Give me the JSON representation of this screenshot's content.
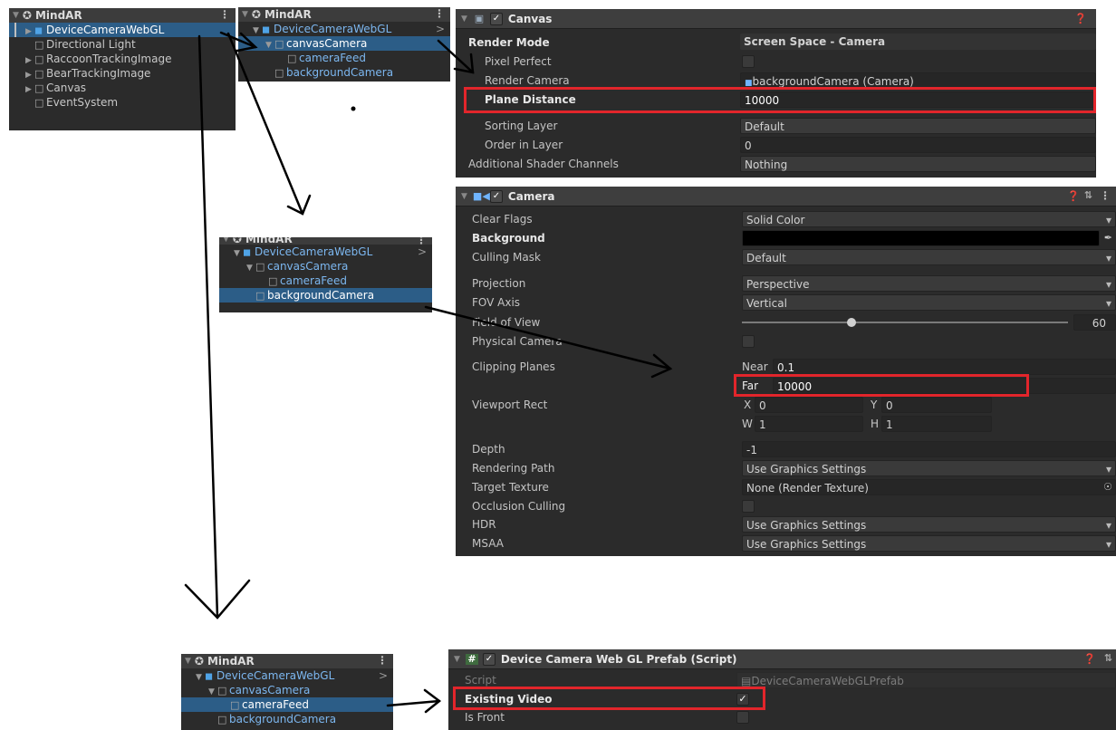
{
  "hierarchy1": {
    "title": "MindAR",
    "items": [
      {
        "label": "DeviceCameraWebGL"
      },
      {
        "label": "Directional Light"
      },
      {
        "label": "RaccoonTrackingImage"
      },
      {
        "label": "BearTrackingImage"
      },
      {
        "label": "Canvas"
      },
      {
        "label": "EventSystem"
      }
    ]
  },
  "hierarchy2": {
    "title": "MindAR",
    "items": [
      {
        "label": "DeviceCameraWebGL"
      },
      {
        "label": "canvasCamera"
      },
      {
        "label": "cameraFeed"
      },
      {
        "label": "backgroundCamera"
      }
    ]
  },
  "hierarchy3": {
    "title": "MindAR",
    "items": [
      {
        "label": "DeviceCameraWebGL"
      },
      {
        "label": "canvasCamera"
      },
      {
        "label": "cameraFeed"
      },
      {
        "label": "backgroundCamera"
      }
    ]
  },
  "hierarchy4": {
    "title": "MindAR",
    "items": [
      {
        "label": "DeviceCameraWebGL"
      },
      {
        "label": "canvasCamera"
      },
      {
        "label": "cameraFeed"
      },
      {
        "label": "backgroundCamera"
      }
    ]
  },
  "canvas_component": {
    "title": "Canvas",
    "render_mode_label": "Render Mode",
    "render_mode_value": "Screen Space - Camera",
    "pixel_perfect_label": "Pixel Perfect",
    "render_camera_label": "Render Camera",
    "render_camera_value": "backgroundCamera (Camera)",
    "plane_distance_label": "Plane Distance",
    "plane_distance_value": "10000",
    "sorting_layer_label": "Sorting Layer",
    "sorting_layer_value": "Default",
    "order_in_layer_label": "Order in Layer",
    "order_in_layer_value": "0",
    "shader_channels_label": "Additional Shader Channels",
    "shader_channels_value": "Nothing"
  },
  "camera_component": {
    "title": "Camera",
    "clear_flags_label": "Clear Flags",
    "clear_flags_value": "Solid Color",
    "background_label": "Background",
    "culling_mask_label": "Culling Mask",
    "culling_mask_value": "Default",
    "projection_label": "Projection",
    "projection_value": "Perspective",
    "fov_axis_label": "FOV Axis",
    "fov_axis_value": "Vertical",
    "fov_label": "Field of View",
    "fov_value": "60",
    "physical_camera_label": "Physical Camera",
    "clipping_label": "Clipping Planes",
    "near_label": "Near",
    "near_value": "0.1",
    "far_label": "Far",
    "far_value": "10000",
    "viewport_label": "Viewport Rect",
    "x_label": "X",
    "x_value": "0",
    "y_label": "Y",
    "y_value": "0",
    "w_label": "W",
    "w_value": "1",
    "h_label": "H",
    "h_value": "1",
    "depth_label": "Depth",
    "depth_value": "-1",
    "rendering_path_label": "Rendering Path",
    "rendering_path_value": "Use Graphics Settings",
    "target_texture_label": "Target Texture",
    "target_texture_value": "None (Render Texture)",
    "occlusion_label": "Occlusion Culling",
    "hdr_label": "HDR",
    "hdr_value": "Use Graphics Settings",
    "msaa_label": "MSAA",
    "msaa_value": "Use Graphics Settings"
  },
  "script_component": {
    "title": "Device Camera Web GL Prefab (Script)",
    "script_label": "Script",
    "script_value": "DeviceCameraWebGLPrefab",
    "existing_video_label": "Existing Video",
    "is_front_label": "Is Front"
  },
  "colors": {
    "panel": "#2b2b2b",
    "selection": "#2c5d87",
    "highlight": "#e2252b"
  }
}
